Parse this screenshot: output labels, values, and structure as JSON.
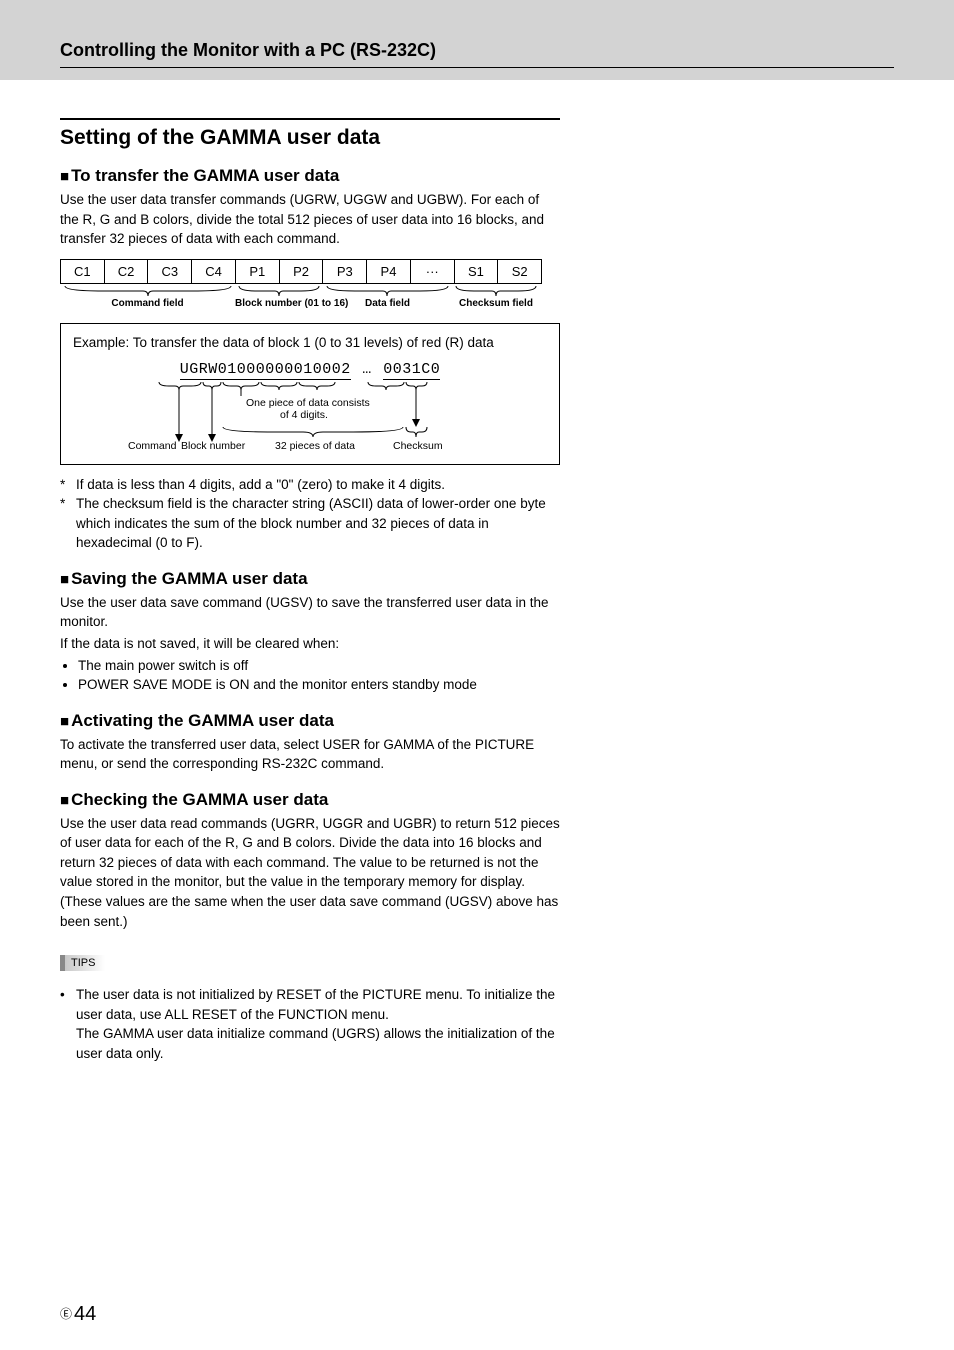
{
  "header": {
    "title": "Controlling the Monitor with a PC (RS-232C)"
  },
  "section": {
    "heading": "Setting of the GAMMA user data"
  },
  "sub1": {
    "title": "To transfer the GAMMA user data",
    "body": "Use the user data transfer commands (UGRW, UGGW and UGBW). For each of the R, G and B colors, divide the total 512 pieces of user data into 16 blocks, and transfer 32 pieces of data with each command."
  },
  "cells": [
    "C1",
    "C2",
    "C3",
    "C4",
    "P1",
    "P2",
    "P3",
    "P4",
    "···",
    "S1",
    "S2"
  ],
  "bracket_labels": {
    "cmd": "Command field",
    "block": "Block number (01 to 16)",
    "data": "Data field",
    "chk": "Checksum field"
  },
  "example": {
    "intro": "Example: To transfer the data of block 1 (0 to 31 levels) of red (R) data",
    "mono": {
      "a": "UGRW",
      "b": "01",
      "c": "0000",
      "d": "0001",
      "e": "0002",
      "ell": " … ",
      "f": "0031",
      "g": "C0"
    },
    "note": "One piece of data consists of 4 digits.",
    "lab_cmd": "Command",
    "lab_blk": "Block number",
    "lab_data": "32 pieces of data",
    "lab_chk": "Checksum"
  },
  "stars": [
    "If data is less than 4 digits, add a \"0\" (zero) to make it 4 digits.",
    "The checksum field is the character string (ASCII) data of lower-order one byte which indicates the sum of the block number and 32 pieces of data in hexadecimal (0 to F)."
  ],
  "sub2": {
    "title": "Saving the GAMMA user data",
    "p1": "Use the user data save command (UGSV) to save the transferred user data in the monitor.",
    "p2": "If the data is not saved, it will be cleared when:",
    "bullets": [
      "The main power switch is off",
      "POWER SAVE MODE is ON and the monitor enters standby mode"
    ]
  },
  "sub3": {
    "title": "Activating the GAMMA user data",
    "body": "To activate the transferred user data, select USER for GAMMA of the PICTURE menu, or send the corresponding RS-232C command."
  },
  "sub4": {
    "title": "Checking the GAMMA user data",
    "body": "Use the user data read commands (UGRR, UGGR and UGBR) to return 512 pieces of user data for each of the R, G and B colors. Divide the data into 16 blocks and return 32 pieces of data with each command. The value to be returned is not the value stored in the monitor, but the value in the temporary memory for display. (These values are the same when the user data save command (UGSV) above has been sent.)"
  },
  "tips": {
    "label": "TIPS",
    "t1": "The user data is not initialized by RESET of the PICTURE menu. To initialize the user data, use ALL RESET of the FUNCTION menu.",
    "t2": "The GAMMA user data initialize command (UGRS) allows the initialization of the user data only."
  },
  "page": {
    "circ": "E",
    "num": "44"
  }
}
